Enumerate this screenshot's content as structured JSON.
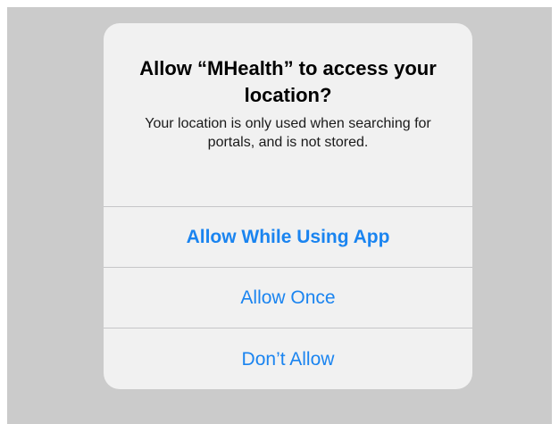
{
  "alert": {
    "title": "Allow “MHealth” to access your location?",
    "message": "Your location is only used when searching for portals, and is not stored.",
    "buttons": {
      "allow_while_using": "Allow While Using App",
      "allow_once": "Allow Once",
      "dont_allow": "Don’t Allow"
    }
  },
  "colors": {
    "accent": "#1a84f0",
    "dim_background": "#cbcbcb",
    "alert_background": "#f1f1f1",
    "separator": "#c6c6c8"
  }
}
